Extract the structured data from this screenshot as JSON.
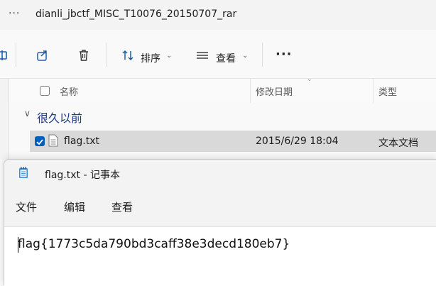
{
  "explorer": {
    "title_dots": "···",
    "path": "dianli_jbctf_MISC_T10076_20150707_rar",
    "toolbar": {
      "sort_label": "排序",
      "view_label": "查看",
      "more_label": "···"
    },
    "columns": {
      "name": "名称",
      "modified": "修改日期",
      "type": "类型"
    },
    "group_label": "很久以前",
    "files": [
      {
        "name": "flag.txt",
        "modified": "2015/6/29 18:04",
        "type": "文本文档",
        "selected": true
      }
    ]
  },
  "notepad": {
    "title": "flag.txt - 记事本",
    "menu": [
      "文件",
      "编辑",
      "查看"
    ],
    "content": "flag{1773c5da790bd3caff38e3decd180eb7}"
  },
  "colors": {
    "accent": "#005fb8",
    "group_text": "#1f3a8a",
    "selection": "#d9d9d9"
  }
}
